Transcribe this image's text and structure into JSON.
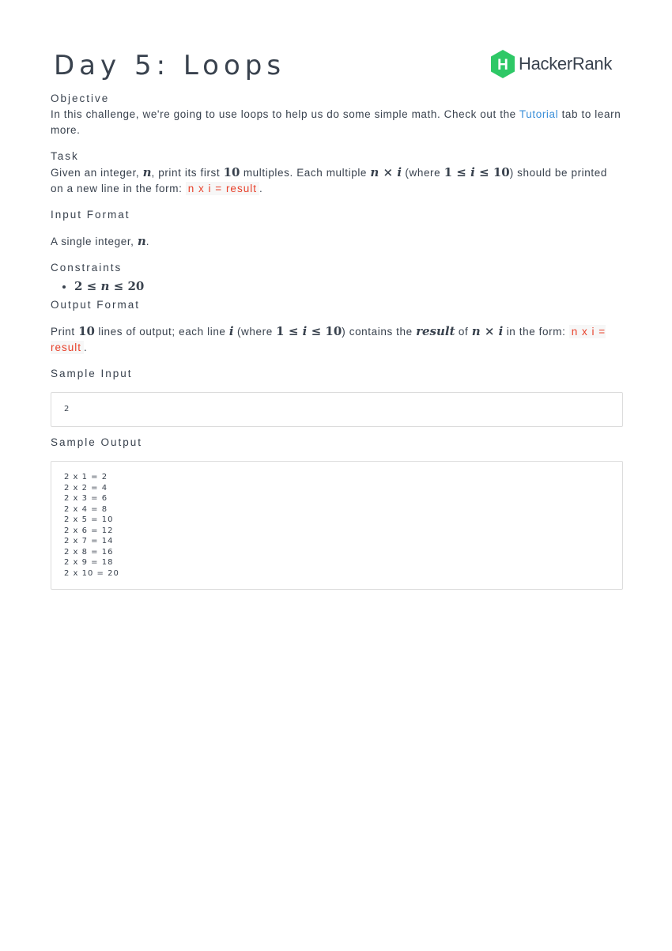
{
  "title": "Day 5: Loops",
  "brand": {
    "name": "HackerRank",
    "logo_letter": "H",
    "logo_color": "#2ec866"
  },
  "objective": {
    "heading": "Objective",
    "text_before": "In this challenge, we're going to use loops to help us do some simple math. Check out the ",
    "link": "Tutorial",
    "text_after": " tab to learn more."
  },
  "task": {
    "heading": "Task",
    "t1": "Given an integer, ",
    "n": "n",
    "t2": ", print its first ",
    "ten": "10",
    "t3": " multiples. Each multiple ",
    "i": "i",
    "t4": " (where ",
    "one": "1",
    "t5": ") should be printed on a new line in the form: ",
    "code": "n x i = result",
    "t6": "."
  },
  "input_format": {
    "heading": "Input Format",
    "t1": "A single integer, ",
    "n": "n",
    "t2": "."
  },
  "constraints": {
    "heading": "Constraints",
    "low": "2",
    "var": "n",
    "high": "20"
  },
  "output_format": {
    "heading": "Output Format",
    "t1": "Print ",
    "ten": "10",
    "t2": " lines of output; each line ",
    "i": "i",
    "t3": " (where ",
    "one": "1",
    "t4": ") contains the ",
    "result": "result",
    "t5": " of ",
    "n": "n",
    "t6": " in the form: ",
    "code": "n x i = result",
    "t7": "."
  },
  "sample_input": {
    "heading": "Sample Input",
    "lines": [
      "2"
    ]
  },
  "sample_output": {
    "heading": "Sample Output",
    "lines": [
      "2 x 1 = 2",
      "2 x 2 = 4",
      "2 x 3 = 6",
      "2 x 4 = 8",
      "2 x 5 = 10",
      "2 x 6 = 12",
      "2 x 7 = 14",
      "2 x 8 = 16",
      "2 x 9 = 18",
      "2 x 10 = 20"
    ]
  },
  "symbols": {
    "times": "×",
    "leq": "≤"
  }
}
